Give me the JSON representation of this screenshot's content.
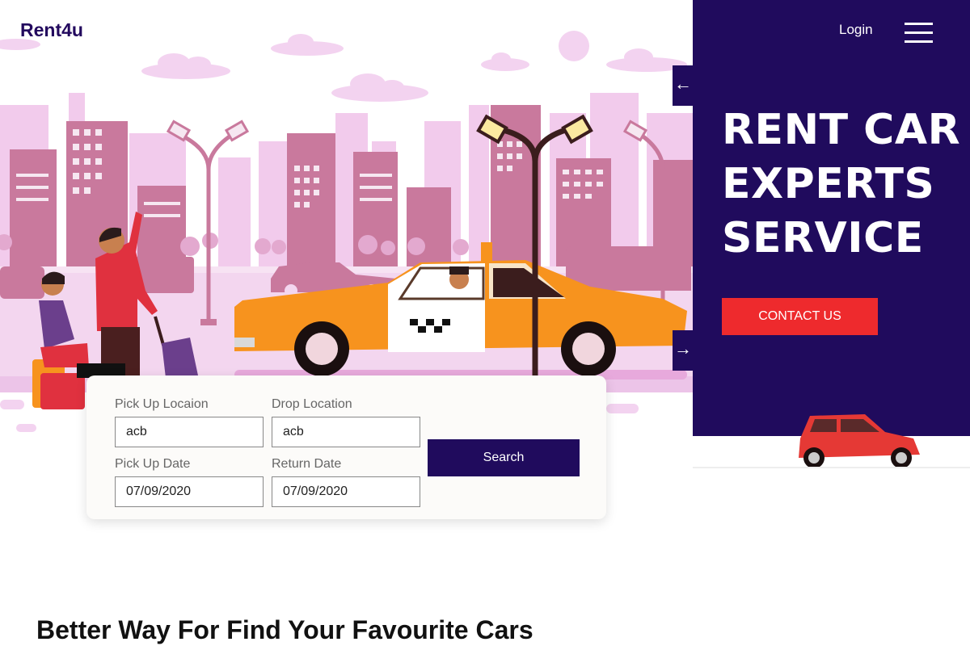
{
  "header": {
    "logo": "Rent4u",
    "login_label": "Login"
  },
  "hero": {
    "title_lines": [
      "RENT CAR",
      "EXPERTS",
      "SERVICE"
    ],
    "contact_label": "CONTACT US",
    "prev_arrow": "←",
    "next_arrow": "→"
  },
  "search_form": {
    "pickup_location": {
      "label": "Pick Up Locaion",
      "value": "acb"
    },
    "drop_location": {
      "label": "Drop Location",
      "value": "acb"
    },
    "pickup_date": {
      "label": "Pick Up Date",
      "value": "07/09/2020"
    },
    "return_date": {
      "label": "Return Date",
      "value": "07/09/2020"
    },
    "search_label": "Search"
  },
  "section": {
    "heading": "Better Way For Find Your Favourite Cars"
  },
  "colors": {
    "brand_dark": "#200b5d",
    "accent_red": "#ee2a2d",
    "taxi_orange": "#f7931e",
    "city_pink": "#c9799d"
  },
  "icons": [
    "menu-icon",
    "arrow-left-icon",
    "arrow-right-icon"
  ]
}
